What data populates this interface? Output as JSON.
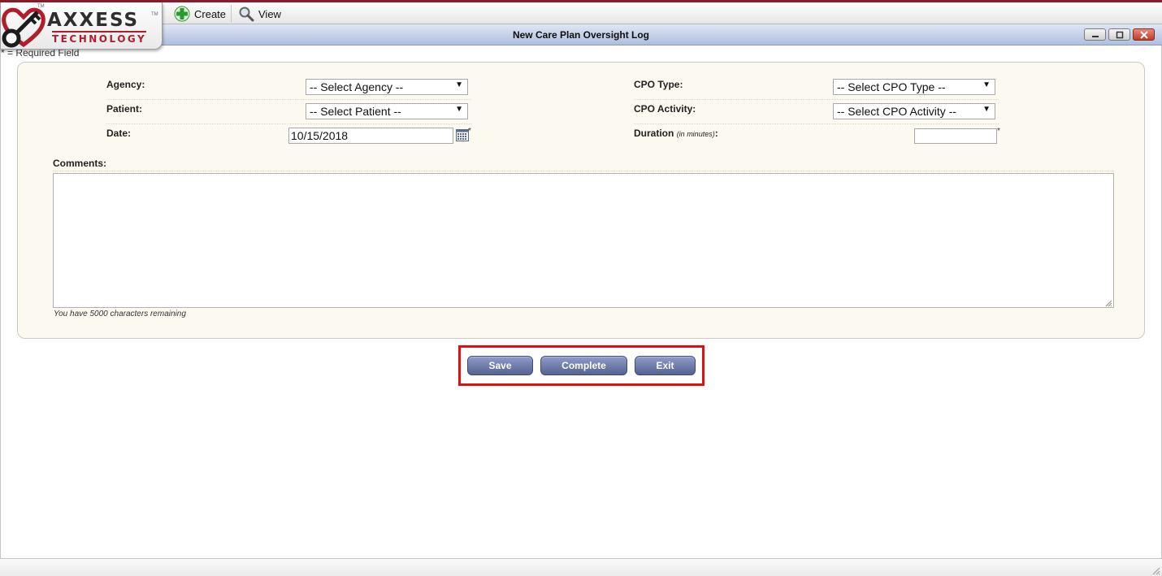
{
  "app": {
    "brand_line1": "AXXESS",
    "brand_line2": "TECHNOLOGY",
    "brand_tm": "TM",
    "brand_color": "#b01e2e"
  },
  "menu": {
    "create": {
      "label": "Create",
      "icon": "plus-icon",
      "color": "#2a9a2a"
    },
    "view": {
      "label": "View",
      "icon": "magnifier-icon"
    }
  },
  "window": {
    "title": "New Care Plan Oversight Log",
    "controls": [
      "minimize-icon",
      "maximize-icon",
      "close-icon"
    ]
  },
  "form": {
    "required_note": "* = Required Field",
    "required_marker": "*",
    "agency": {
      "label": "Agency:",
      "value": "-- Select Agency --"
    },
    "patient": {
      "label": "Patient:",
      "value": "-- Select Patient --"
    },
    "date": {
      "label": "Date:",
      "value": "10/15/2018",
      "icon": "calendar-icon"
    },
    "cpo_type": {
      "label": "CPO Type:",
      "value": "-- Select CPO Type --"
    },
    "cpo_activity": {
      "label": "CPO Activity:",
      "value": "-- Select CPO Activity --"
    },
    "duration": {
      "label": "Duration",
      "hint": "(in minutes)",
      "suffix": ":",
      "value": ""
    },
    "comments": {
      "label": "Comments:",
      "value": "",
      "chars_remaining": "You have 5000 characters remaining"
    }
  },
  "actions": {
    "save": "Save",
    "complete": "Complete",
    "exit": "Exit",
    "highlight_color": "#e01010",
    "button_color": "#56628f"
  }
}
